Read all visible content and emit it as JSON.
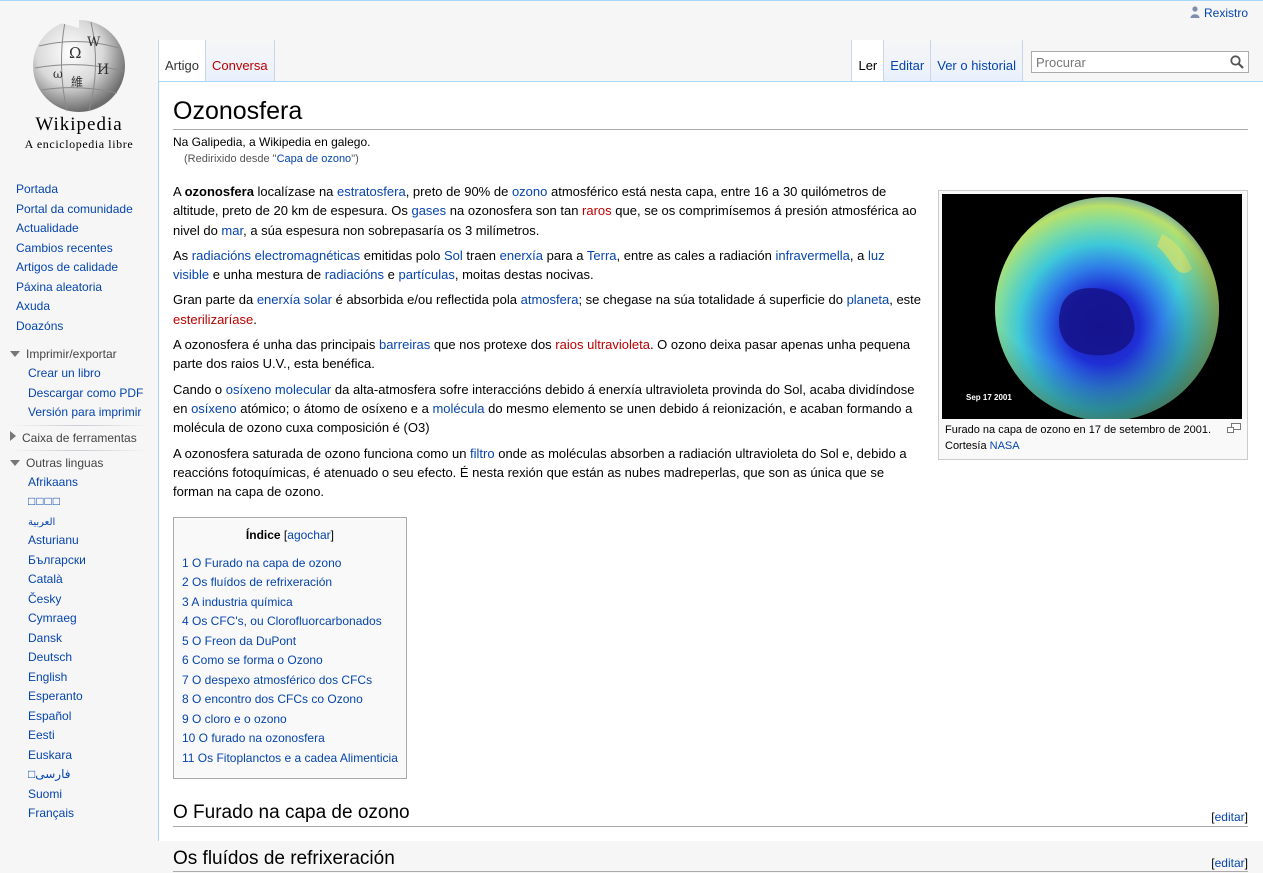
{
  "personal": {
    "login_label": "Rexistro"
  },
  "logo": {
    "wordmark": "Wikipedia",
    "tagline": "A enciclopedia libre"
  },
  "sidebar": {
    "nav": [
      "Portada",
      "Portal da comunidade",
      "Actualidade",
      "Cambios recentes",
      "Artigos de calidade",
      "Páxina aleatoria",
      "Axuda",
      "Doazóns"
    ],
    "print": {
      "title": "Imprimir/exportar",
      "items": [
        "Crear un libro",
        "Descargar como PDF",
        "Versión para imprimir"
      ]
    },
    "tools": {
      "title": "Caixa de ferramentas"
    },
    "langs": {
      "title": "Outras linguas",
      "items": [
        "Afrikaans",
        "□□□□",
        "العربية",
        "Asturianu",
        "Български",
        "Català",
        "Česky",
        "Cymraeg",
        "Dansk",
        "Deutsch",
        "English",
        "Esperanto",
        "Español",
        "Eesti",
        "Euskara",
        "□فارسی",
        "Suomi",
        "Français"
      ]
    }
  },
  "tabs": {
    "article": "Artigo",
    "talk": "Conversa",
    "read": "Ler",
    "edit": "Editar",
    "history": "Ver o historial"
  },
  "search": {
    "placeholder": "Procurar"
  },
  "page": {
    "title": "Ozonosfera",
    "site_sub": "Na Galipedia, a Wikipedia en galego.",
    "redirect_prefix": "(Redirixido desde \"",
    "redirect_link": "Capa de ozono",
    "redirect_suffix": "\")"
  },
  "paragraphs": [
    [
      [
        "t",
        "A "
      ],
      [
        "b",
        "ozonosfera"
      ],
      [
        "t",
        " localízase na "
      ],
      [
        "a",
        "estratosfera"
      ],
      [
        "t",
        ", preto de 90% de "
      ],
      [
        "a",
        "ozono"
      ],
      [
        "t",
        " atmosférico está nesta capa, entre 16 a 30 quilómetros de altitude, preto de 20 km de espesura. Os "
      ],
      [
        "a",
        "gases"
      ],
      [
        "t",
        " na ozonosfera son tan "
      ],
      [
        "r",
        "raros"
      ],
      [
        "t",
        " que, se os comprimísemos á presión atmosférica ao nivel do "
      ],
      [
        "a",
        "mar"
      ],
      [
        "t",
        ", a súa espesura non sobrepasaría os 3 milímetros."
      ]
    ],
    [
      [
        "t",
        "As "
      ],
      [
        "a",
        "radiacións electromagnéticas"
      ],
      [
        "t",
        " emitidas polo "
      ],
      [
        "a",
        "Sol"
      ],
      [
        "t",
        " traen "
      ],
      [
        "a",
        "enerxía"
      ],
      [
        "t",
        " para a "
      ],
      [
        "a",
        "Terra"
      ],
      [
        "t",
        ", entre as cales a radiación "
      ],
      [
        "a",
        "infravermella"
      ],
      [
        "t",
        ", a "
      ],
      [
        "a",
        "luz visible"
      ],
      [
        "t",
        " e unha mestura de "
      ],
      [
        "a",
        "radiacións"
      ],
      [
        "t",
        " e "
      ],
      [
        "a",
        "partículas"
      ],
      [
        "t",
        ", moitas destas nocivas."
      ]
    ],
    [
      [
        "t",
        "Gran parte da "
      ],
      [
        "a",
        "enerxía solar"
      ],
      [
        "t",
        " é absorbida e/ou reflectida pola "
      ],
      [
        "a",
        "atmosfera"
      ],
      [
        "t",
        "; se chegase na súa totalidade á superficie do "
      ],
      [
        "a",
        "planeta"
      ],
      [
        "t",
        ", este "
      ],
      [
        "r",
        "esterilizaríase"
      ],
      [
        "t",
        "."
      ]
    ],
    [
      [
        "t",
        "A ozonosfera é unha das principais "
      ],
      [
        "a",
        "barreiras"
      ],
      [
        "t",
        " que nos protexe dos "
      ],
      [
        "r",
        "raios ultravioleta"
      ],
      [
        "t",
        ". O ozono deixa pasar apenas unha pequena parte dos raios U.V., esta benéfica."
      ]
    ],
    [
      [
        "t",
        "Cando o "
      ],
      [
        "a",
        "osíxeno molecular"
      ],
      [
        "t",
        " da alta-atmosfera sofre interaccións debido á enerxía ultravioleta provinda do Sol, acaba dividíndose en "
      ],
      [
        "a",
        "osíxeno"
      ],
      [
        "t",
        " atómico; o átomo de osíxeno e a "
      ],
      [
        "a",
        "molécula"
      ],
      [
        "t",
        " do mesmo elemento se unen debido á reionización, e acaban formando a molécula de ozono cuxa composición é (O3)"
      ]
    ],
    [
      [
        "t",
        "A ozonosfera saturada de ozono funciona como un "
      ],
      [
        "a",
        "filtro"
      ],
      [
        "t",
        " onde as moléculas absorben a radiación ultravioleta do Sol e, debido a reaccións fotoquímicas, é atenuado o seu efecto. É nesta rexión que están as nubes madreperlas, que son as única que se forman na capa de ozono."
      ]
    ]
  ],
  "thumb": {
    "image_label": "Sep  17 2001",
    "caption": "Furado na capa de ozono en 17 de setembro de 2001. Cortesía ",
    "caption_link": "NASA"
  },
  "toc": {
    "title": "Índice",
    "toggle": "agochar",
    "items": [
      "1 O Furado na capa de ozono",
      "2 Os fluídos de refrixeración",
      "3 A industria química",
      "4 Os CFC's, ou Clorofluorcarbonados",
      "5 O Freon da DuPont",
      "6 Como se forma o Ozono",
      "7 O despexo atmosférico dos CFCs",
      "8 O encontro dos CFCs co Ozono",
      "9 O cloro e o ozono",
      "10 O furado na ozonosfera",
      "11 Os Fitoplanctos e a cadea Alimenticia"
    ]
  },
  "sections": [
    {
      "title": "O Furado na capa de ozono",
      "edit": "editar"
    },
    {
      "title": "Os fluídos de refrixeración",
      "edit": "editar"
    }
  ]
}
